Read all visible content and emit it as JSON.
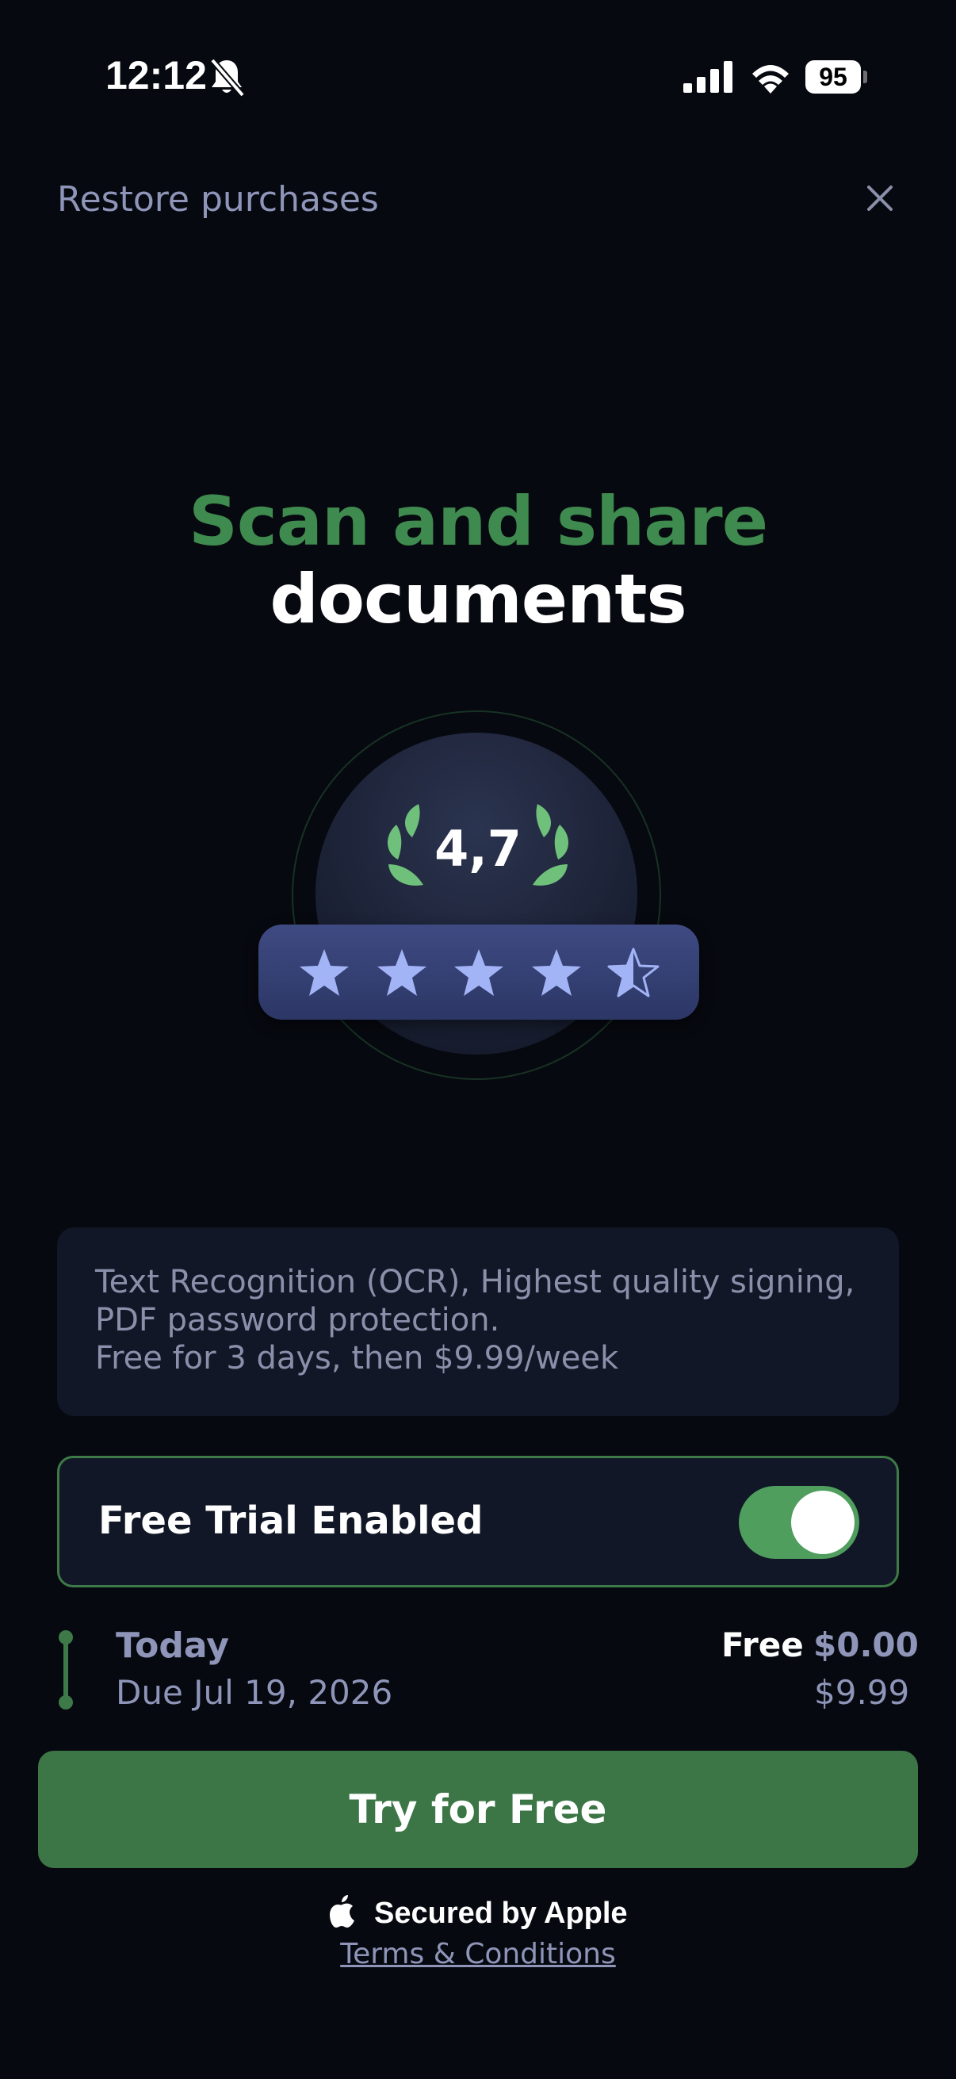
{
  "status_bar": {
    "time": "12:12",
    "battery": "95",
    "icons": [
      "bell-slash-icon",
      "signal-icon",
      "wifi-icon",
      "battery-icon"
    ]
  },
  "header": {
    "restore_label": "Restore purchases",
    "close_icon": "close-icon"
  },
  "hero": {
    "title_line1": "Scan and share",
    "title_line2": "documents",
    "title_accent_color": "#3f8a4e"
  },
  "rating": {
    "value_label": "4,7",
    "stars": 4.5,
    "max_stars": 5,
    "star_color": "#a3b4f6"
  },
  "description": {
    "lines": [
      "Text Recognition (OCR), Highest quality signing,",
      "PDF password protection.",
      "Free for 3 days, then $9.99/week"
    ]
  },
  "trial": {
    "label": "Free Trial Enabled",
    "enabled": true,
    "toggle_color": "#4f9e5e"
  },
  "timeline": {
    "today_label": "Today",
    "today_tag": "Free",
    "today_price": "$0.00",
    "due_label": "Due Jul 19, 2026",
    "due_price": "$9.99"
  },
  "cta": {
    "label": "Try for Free",
    "color": "#3c7646"
  },
  "footer": {
    "secured_label": "Secured by Apple",
    "terms_label": "Terms & Conditions"
  }
}
